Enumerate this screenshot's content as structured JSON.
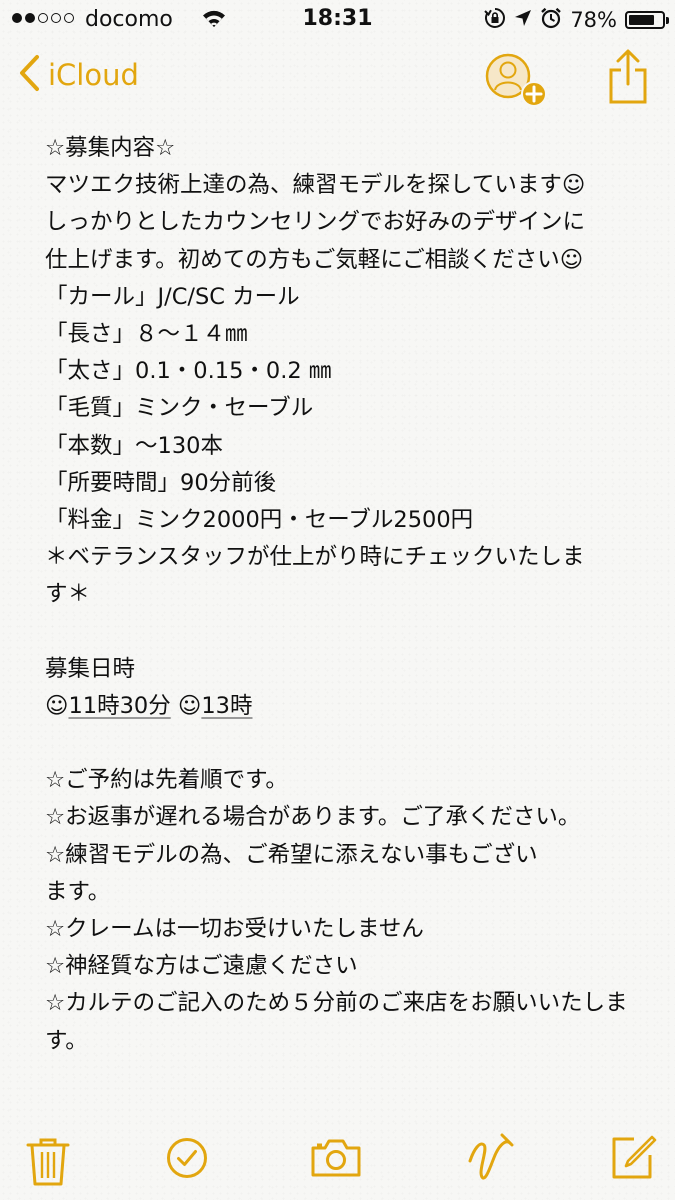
{
  "status": {
    "signal_strength": 2,
    "signal_max": 5,
    "carrier": "docomo",
    "time": "18:31",
    "battery_percent": "78%",
    "battery_level": 0.78
  },
  "nav": {
    "back_label": "iCloud",
    "accent_color": "#e2a60f"
  },
  "note": {
    "heading": "☆募集内容☆",
    "intro_lines": [
      "マツエク技術上達の為、練習モデルを探しています☺",
      "しっかりとしたカウンセリングでお好みのデザインに",
      "仕上げます。初めての方もご気軽にご相談ください☺"
    ],
    "spec_lines": [
      "「カール」J/C/SC カール",
      "「長さ」８〜１４㎜",
      "「太さ」0.1・0.15・0.2 ㎜",
      "「毛質」ミンク・セーブル",
      "「本数」〜130本",
      "「所要時間」90分前後",
      "「料金」ミンク2000円・セーブル2500円",
      "＊ベテランスタッフが仕上がり時にチェックいたしま",
      "す＊"
    ],
    "schedule_heading": "募集日時",
    "schedule": {
      "emoji": "☺",
      "slot_1": "11時30分",
      "slot_2": "13時"
    },
    "notice_lines": [
      "☆ご予約は先着順です。",
      "☆お返事が遅れる場合があります。ご了承ください。",
      "☆練習モデルの為、ご希望に添えない事もござい",
      "ます。",
      "☆クレームは一切お受けいたしません",
      "☆神経質な方はご遠慮ください",
      "☆カルテのご記入のため５分前のご来店をお願いいたしま",
      "す。"
    ]
  },
  "toolbar": {
    "icons": [
      "trash-icon",
      "checklist-icon",
      "camera-icon",
      "sketch-icon",
      "compose-icon"
    ]
  }
}
